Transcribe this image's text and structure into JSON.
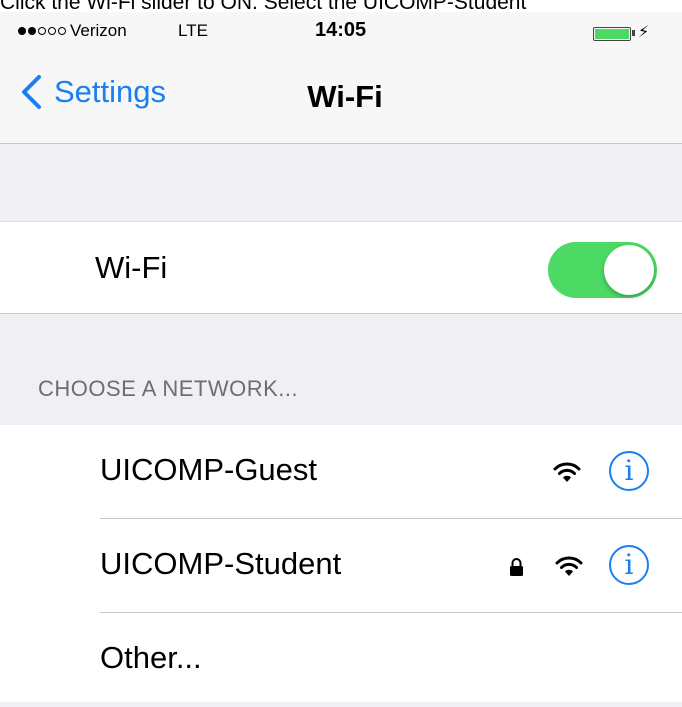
{
  "caption": "Click the Wi-Fi slider to ON. Select the UICOMP-Student",
  "status_bar": {
    "carrier": "Verizon",
    "network": "LTE",
    "time": "14:05",
    "signal_strength": 2,
    "battery_color": "#4cd964"
  },
  "nav": {
    "back_label": "Settings",
    "back_icon": "chevron-left-icon",
    "title": "Wi-Fi"
  },
  "wifi_toggle": {
    "label": "Wi-Fi",
    "state": "on",
    "on_color": "#4cd964"
  },
  "section_header": "CHOOSE A NETWORK...",
  "networks": [
    {
      "name": "UICOMP-Guest",
      "secured": false,
      "signal_icon": "wifi-signal-icon",
      "info_icon": "info-icon"
    },
    {
      "name": "UICOMP-Student",
      "secured": true,
      "signal_icon": "wifi-signal-icon",
      "info_icon": "info-icon"
    }
  ],
  "other_label": "Other...",
  "accent_color": "#1a7ff0"
}
